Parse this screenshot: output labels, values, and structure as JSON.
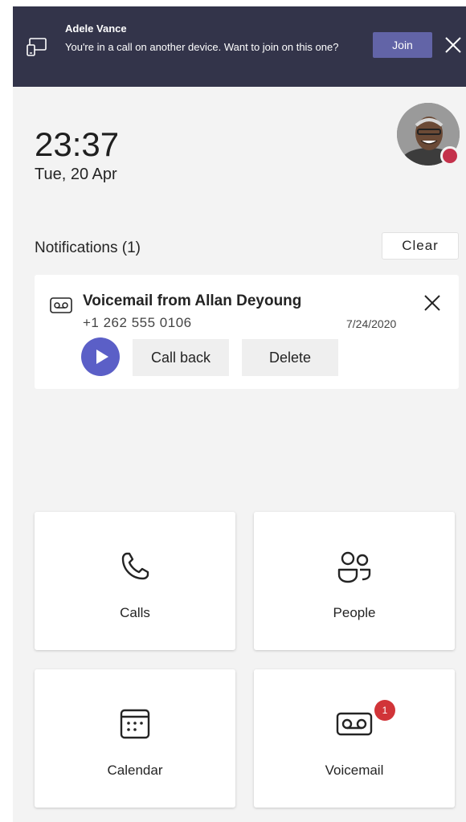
{
  "banner": {
    "caller_name": "Adele Vance",
    "message": "You're in a call on another device. Want to join on this one?",
    "join_label": "Join",
    "background": "#33344a",
    "join_color": "#6264a7",
    "icon": "transfer-device-icon"
  },
  "clock": {
    "time": "23:37",
    "date": "Tue, 20 Apr"
  },
  "user": {
    "status_color": "#c4314b",
    "status": "busy"
  },
  "notifications": {
    "heading": "Notifications (1)",
    "clear_label": "Clear",
    "items": [
      {
        "icon": "voicemail-icon",
        "title": "Voicemail from Allan Deyoung",
        "phone": "+1 262 555 0106",
        "date": "7/24/2020",
        "call_back_label": "Call back",
        "delete_label": "Delete"
      }
    ]
  },
  "tiles": [
    {
      "label": "Calls",
      "icon": "phone-icon"
    },
    {
      "label": "People",
      "icon": "people-icon"
    },
    {
      "label": "Calendar",
      "icon": "calendar-icon"
    },
    {
      "label": "Voicemail",
      "icon": "voicemail-icon",
      "badge": "1"
    }
  ],
  "colors": {
    "accent": "#5b5fc7",
    "badge": "#d13438",
    "background": "#f3f3f3"
  }
}
